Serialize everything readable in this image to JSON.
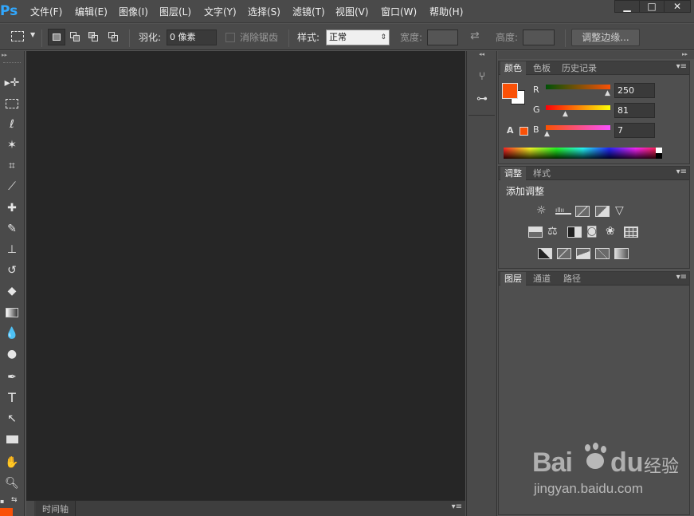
{
  "app": {
    "logo": "Ps"
  },
  "menubar": {
    "items": [
      "文件(F)",
      "编辑(E)",
      "图像(I)",
      "图层(L)",
      "文字(Y)",
      "选择(S)",
      "滤镜(T)",
      "视图(V)",
      "窗口(W)",
      "帮助(H)"
    ],
    "window_buttons": {
      "minimize": "▁",
      "maximize": "□",
      "close": "✕"
    }
  },
  "optionsbar": {
    "feather_label": "羽化:",
    "feather_value": "0 像素",
    "antialias_label": "消除锯齿",
    "style_label": "样式:",
    "style_value": "正常",
    "width_label": "宽度:",
    "height_label": "高度:",
    "refine_edge_button": "调整边缘..."
  },
  "tools": [
    "move-tool",
    "marquee-tool",
    "lasso-tool",
    "magic-wand-tool",
    "crop-tool",
    "eyedropper-tool",
    "healing-brush-tool",
    "brush-tool",
    "clone-stamp-tool",
    "history-brush-tool",
    "eraser-tool",
    "gradient-tool",
    "blur-tool",
    "dodge-tool",
    "pen-tool",
    "type-tool",
    "path-selection-tool",
    "rectangle-tool",
    "hand-tool",
    "zoom-tool"
  ],
  "color_panel": {
    "tabs": [
      "颜色",
      "色板",
      "历史记录"
    ],
    "r_label": "R",
    "g_label": "G",
    "b_label": "B",
    "r_value": "250",
    "g_value": "81",
    "b_value": "7",
    "foreground_color": "#fa5107",
    "background_color": "#ffffff"
  },
  "adjustments_panel": {
    "tabs": [
      "调整",
      "样式"
    ],
    "heading": "添加调整"
  },
  "layers_panel": {
    "tabs": [
      "图层",
      "通道",
      "路径"
    ]
  },
  "timeline": {
    "label": "时间轴"
  },
  "watermark": {
    "brand": "Bai",
    "brand2": "du",
    "cn": "经验",
    "url": "jingyan.baidu.com"
  }
}
